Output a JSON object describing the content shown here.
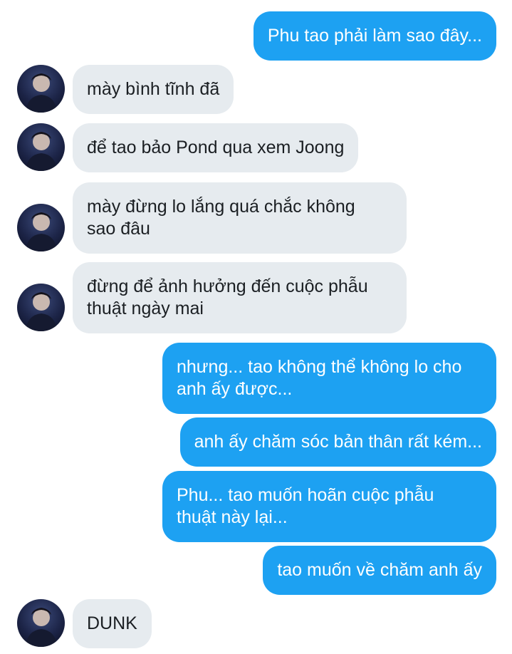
{
  "messages": [
    {
      "sender": "me",
      "lines": [
        "Phu tao phải làm sao đây..."
      ]
    },
    {
      "sender": "friend",
      "lines": [
        "mày bình tĩnh đã"
      ]
    },
    {
      "sender": "friend",
      "lines": [
        "để tao bảo Pond qua xem Joong"
      ]
    },
    {
      "sender": "friend",
      "lines": [
        "mày đừng lo lắng quá chắc không",
        "sao đâu"
      ]
    },
    {
      "sender": "friend",
      "lines": [
        "đừng để ảnh hưởng đến cuộc phẫu",
        "thuật ngày mai"
      ]
    },
    {
      "sender": "me",
      "lines": [
        "nhưng... tao không thể không lo cho",
        "anh ấy được..."
      ]
    },
    {
      "sender": "me",
      "lines": [
        "anh ấy chăm sóc bản thân rất kém..."
      ]
    },
    {
      "sender": "me",
      "lines": [
        "Phu... tao muốn hoãn cuộc phẫu",
        "thuật này lại..."
      ]
    },
    {
      "sender": "me",
      "lines": [
        "tao muốn về chăm anh ấy"
      ]
    },
    {
      "sender": "friend",
      "lines": [
        "DUNK"
      ]
    }
  ],
  "colors": {
    "outgoing_bubble": "#1da1f2",
    "incoming_bubble": "#e6ebef",
    "outgoing_text": "#ffffff",
    "incoming_text": "#1b1f23"
  },
  "icons": {
    "avatar": "friend-avatar-photo"
  }
}
